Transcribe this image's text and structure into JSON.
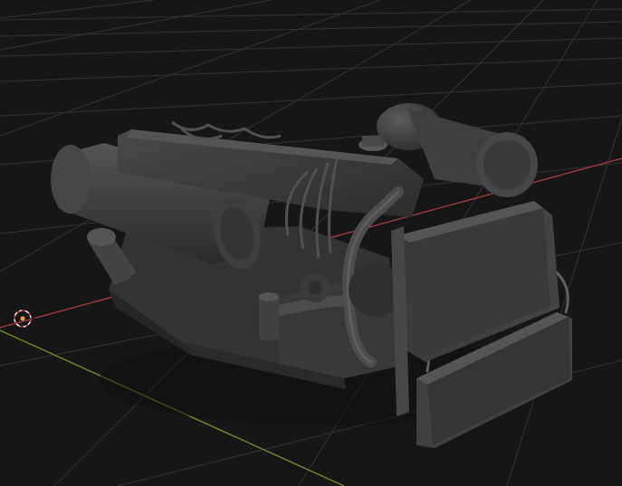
{
  "viewport": {
    "background_color": "#171717",
    "grid_color": "#3a3a3a",
    "x_axis_color": "#a0393f",
    "y_axis_color": "#6b8a25",
    "model_base_color": "#3e3e3e",
    "model_shadow_color": "#262626",
    "model_highlight_color": "#5a5a5a",
    "cursor_icon": "3d-cursor-icon",
    "origin_icon": "origin-marker-icon"
  }
}
